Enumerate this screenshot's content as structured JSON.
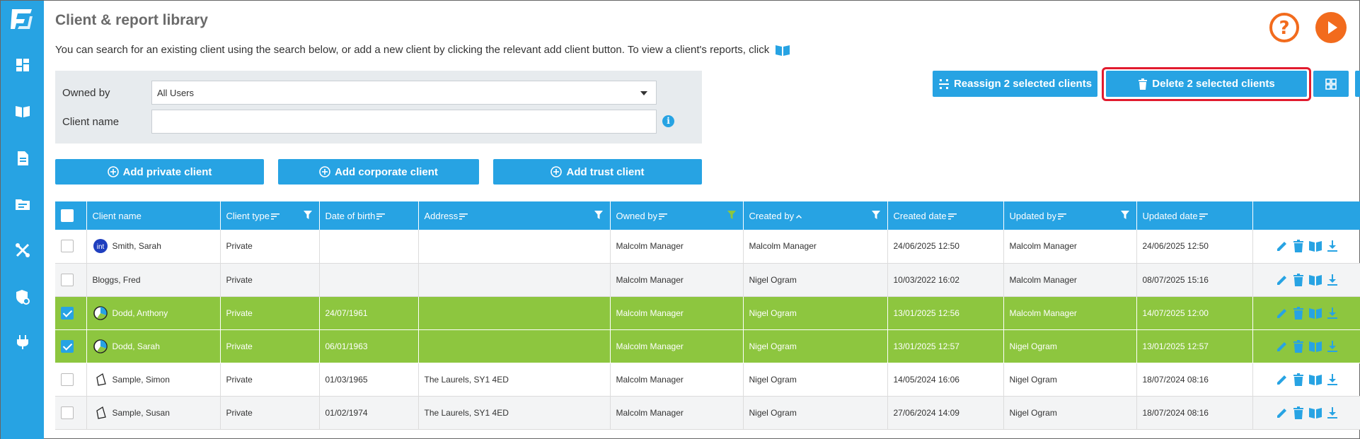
{
  "page": {
    "title": "Client & report library",
    "intro": "You can search for an existing client using the search below, or add a new client by clicking the relevant add client button. To view a client's reports, click"
  },
  "filters": {
    "owned_by_label": "Owned by",
    "owned_by_value": "All Users",
    "client_name_label": "Client name",
    "client_name_value": "",
    "info": "i"
  },
  "actions": {
    "add_private": "Add private client",
    "add_corporate": "Add corporate client",
    "add_trust": "Add trust client",
    "reassign": "Reassign 2 selected clients",
    "delete": "Delete 2 selected clients"
  },
  "table": {
    "columns": [
      "Client name",
      "Client type",
      "Date of birth",
      "Address",
      "Owned by",
      "Created by",
      "Created date",
      "Updated by",
      "Updated date"
    ],
    "rows": [
      {
        "avatar": "int",
        "name": "Smith, Sarah",
        "type": "Private",
        "dob": "",
        "address": "",
        "owned_by": "Malcolm Manager",
        "created_by": "Malcolm Manager",
        "created_date": "24/06/2025 12:50",
        "updated_by": "Malcolm Manager",
        "updated_date": "24/06/2025 12:50",
        "selected": false
      },
      {
        "avatar": "",
        "name": "Bloggs, Fred",
        "type": "Private",
        "dob": "",
        "address": "",
        "owned_by": "Malcolm Manager",
        "created_by": "Nigel Ogram",
        "created_date": "10/03/2022 16:02",
        "updated_by": "Malcolm Manager",
        "updated_date": "08/07/2025 15:16",
        "selected": false
      },
      {
        "avatar": "pie",
        "name": "Dodd, Anthony",
        "type": "Private",
        "dob": "24/07/1961",
        "address": "",
        "owned_by": "Malcolm Manager",
        "created_by": "Nigel Ogram",
        "created_date": "13/01/2025 12:56",
        "updated_by": "Malcolm Manager",
        "updated_date": "14/07/2025 12:00",
        "selected": true
      },
      {
        "avatar": "pie",
        "name": "Dodd, Sarah",
        "type": "Private",
        "dob": "06/01/1963",
        "address": "",
        "owned_by": "Malcolm Manager",
        "created_by": "Nigel Ogram",
        "created_date": "13/01/2025 12:57",
        "updated_by": "Nigel Ogram",
        "updated_date": "13/01/2025 12:57",
        "selected": true
      },
      {
        "avatar": "kite",
        "name": "Sample, Simon",
        "type": "Private",
        "dob": "01/03/1965",
        "address": "The Laurels, SY1 4ED",
        "owned_by": "Malcolm Manager",
        "created_by": "Nigel Ogram",
        "created_date": "14/05/2024 16:06",
        "updated_by": "Nigel Ogram",
        "updated_date": "18/07/2024 08:16",
        "selected": false
      },
      {
        "avatar": "kite",
        "name": "Sample, Susan",
        "type": "Private",
        "dob": "01/02/1974",
        "address": "The Laurels, SY1 4ED",
        "owned_by": "Malcolm Manager",
        "created_by": "Nigel Ogram",
        "created_date": "27/06/2024 14:09",
        "updated_by": "Nigel Ogram",
        "updated_date": "18/07/2024 08:16",
        "selected": false
      }
    ]
  },
  "colors": {
    "accent": "#27a3e3",
    "selected_row": "#8dc63f",
    "orange": "#f26b1d",
    "highlight": "#e11b2e"
  }
}
